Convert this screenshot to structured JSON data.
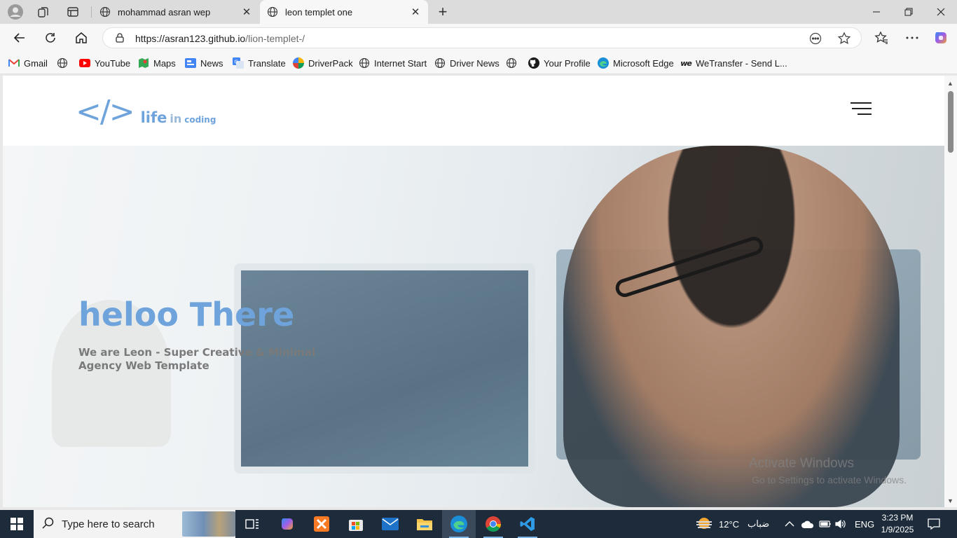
{
  "browser": {
    "tabs": [
      {
        "title": "mohammad asran wep",
        "active": false
      },
      {
        "title": "leon templet one",
        "active": true
      }
    ],
    "address": {
      "host": "https://asran123.github.io",
      "path": "/lion-templet-/"
    }
  },
  "bookmarks": [
    {
      "label": "Gmail",
      "icon": "gmail-icon"
    },
    {
      "label": "",
      "icon": "globe-icon"
    },
    {
      "label": "YouTube",
      "icon": "youtube-icon"
    },
    {
      "label": "Maps",
      "icon": "maps-icon"
    },
    {
      "label": "News",
      "icon": "news-icon"
    },
    {
      "label": "Translate",
      "icon": "translate-icon"
    },
    {
      "label": "DriverPack",
      "icon": "driverpack-icon"
    },
    {
      "label": "Internet Start",
      "icon": "globe-icon"
    },
    {
      "label": "Driver News",
      "icon": "globe-icon"
    },
    {
      "label": "",
      "icon": "globe-icon"
    },
    {
      "label": "Your Profile",
      "icon": "github-icon"
    },
    {
      "label": "Microsoft Edge",
      "icon": "edge-icon"
    },
    {
      "label": "WeTransfer - Send L...",
      "icon": "wetransfer-icon"
    }
  ],
  "site": {
    "logo": {
      "mark": "</>",
      "word1": "life",
      "word2": "in",
      "word3": "coding"
    },
    "hero": {
      "title": "heloo There",
      "subtitle": "We are Leon - Super Creative & Minimal Agency Web Template"
    }
  },
  "watermark": {
    "title": "Activate Windows",
    "subtitle": "Go to Settings to activate Windows."
  },
  "taskbar": {
    "search_placeholder": "Type here to search",
    "weather_temp": "12°C",
    "weather_desc": "ضباب",
    "language": "ENG",
    "time": "3:23 PM",
    "date": "1/9/2025"
  },
  "colors": {
    "accent": "#6fa3dc",
    "taskbar": "#1d2b3a"
  }
}
